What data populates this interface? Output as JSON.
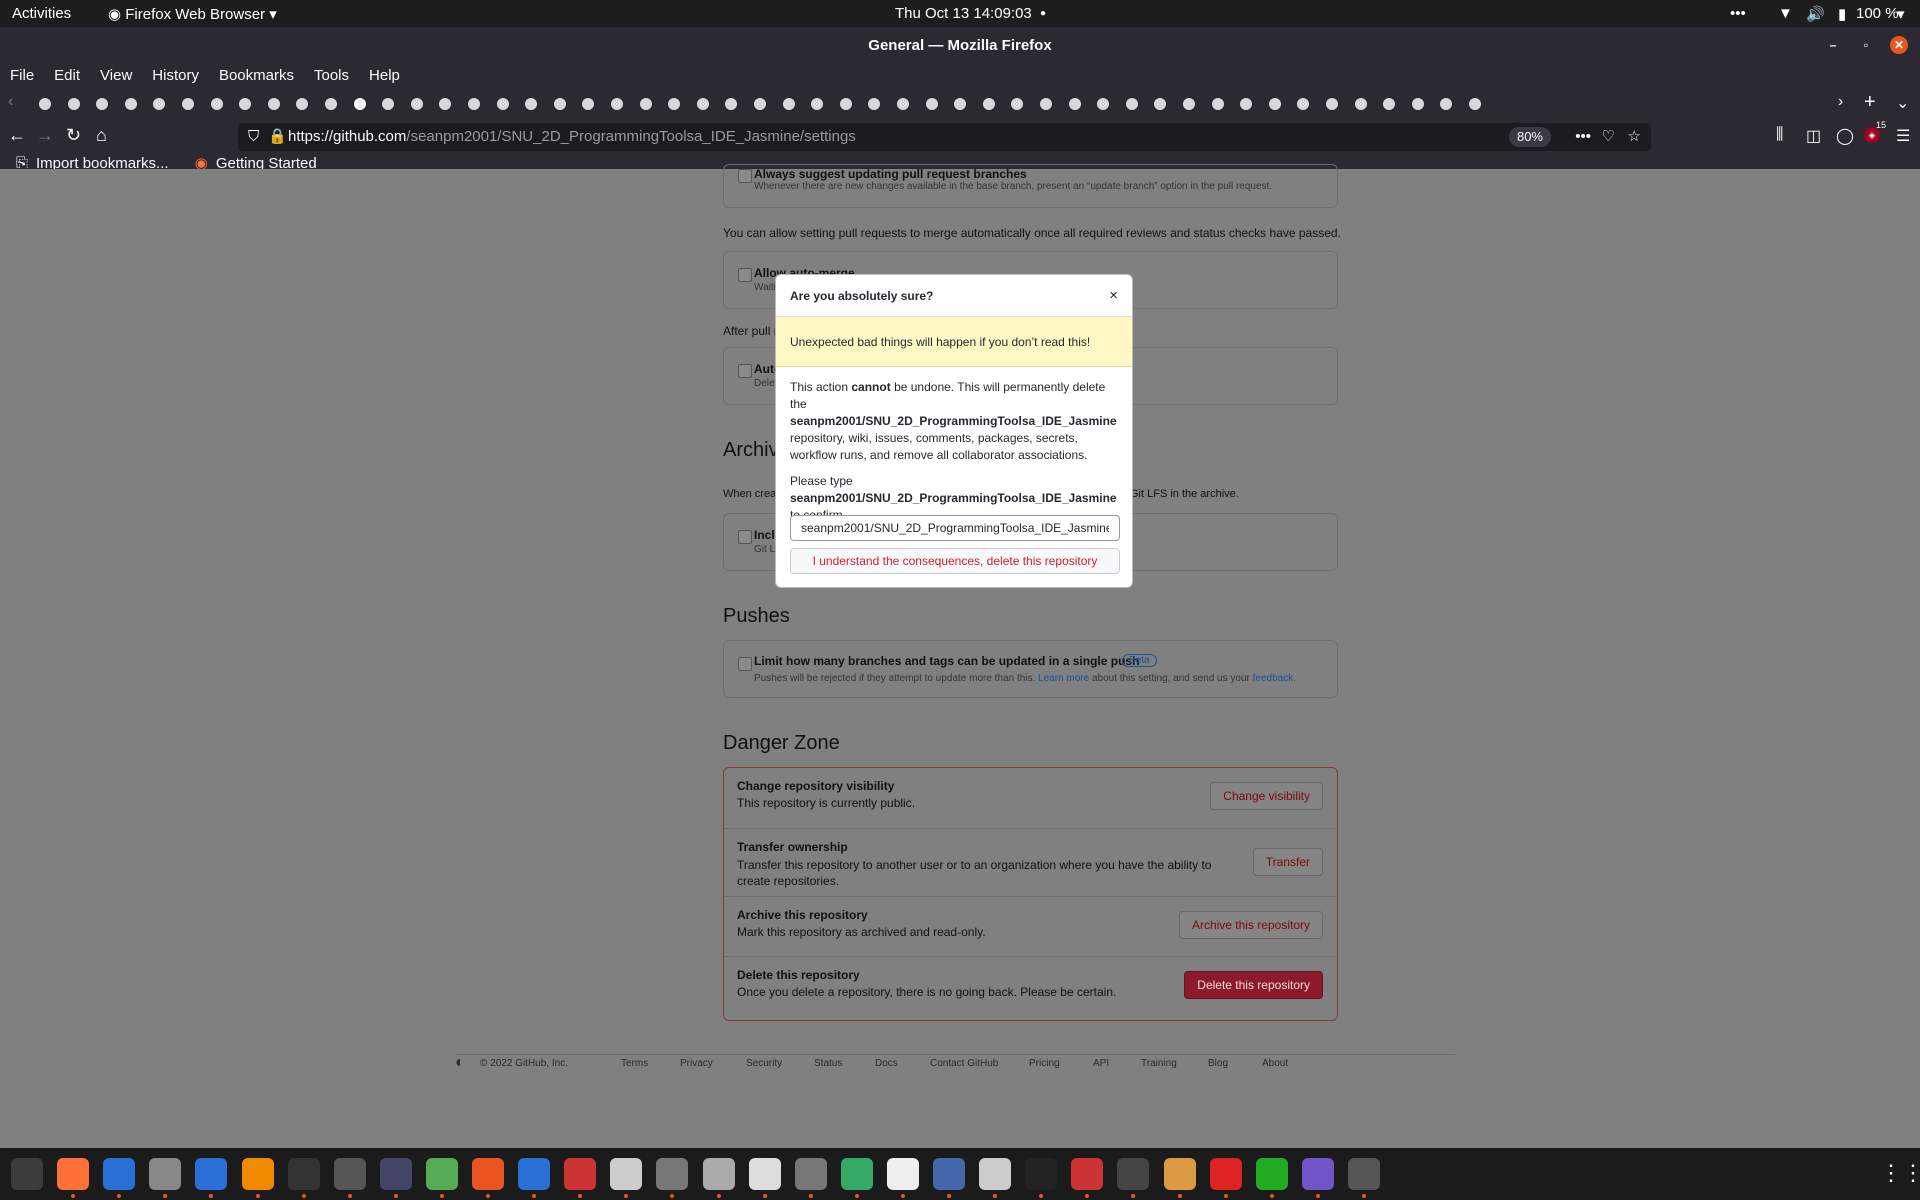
{
  "system_bar": {
    "activities": "Activities",
    "app_menu": "Firefox Web Browser",
    "datetime": "Thu Oct 13  14:09:03",
    "battery": "100 %"
  },
  "window": {
    "title": "General — Mozilla Firefox"
  },
  "menu": [
    "File",
    "Edit",
    "View",
    "History",
    "Bookmarks",
    "Tools",
    "Help"
  ],
  "nav": {
    "url_host": "https://github.com",
    "url_path": "/seanpm2001/SNU_2D_ProgrammingToolsa_IDE_Jasmine/settings",
    "zoom": "80%",
    "notifications_badge": "15"
  },
  "bookmarks": {
    "import": "Import bookmarks...",
    "getting_started": "Getting Started"
  },
  "settings_page": {
    "pr_update_title": "Always suggest updating pull request branches",
    "pr_update_desc": "Whenever there are new changes available in the base branch, present an “update branch” option in the pull request.",
    "automerge_note": "You can allow setting pull requests to merge automatically once all required reviews and status checks have passed.",
    "automerge_title": "Allow auto-merge",
    "automerge_desc": "Waiti",
    "after_pull": "After pull r",
    "autodelete_title": "Auto",
    "autodelete_desc": "Delet",
    "archives_heading": "Archiv",
    "archives_desc_start": "When crea",
    "archives_desc_end": "Git LFS in the archive.",
    "include_lfs_title": "Incl",
    "include_lfs_desc": "Git L",
    "pushes_heading": "Pushes",
    "limit_push_title": "Limit how many branches and tags can be updated in a single push",
    "beta": "Beta",
    "limit_push_desc_a": "Pushes will be rejected if they attempt to update more than this.",
    "learn_more": "Learn more",
    "limit_push_desc_b": "about this setting, and send us your",
    "feedback": "feedback.",
    "danger_heading": "Danger Zone",
    "danger_rows": [
      {
        "title": "Change repository visibility",
        "desc": "This repository is currently public.",
        "button": "Change visibility"
      },
      {
        "title": "Transfer ownership",
        "desc": "Transfer this repository to another user or to an organization where you have the ability to create repositories.",
        "button": "Transfer"
      },
      {
        "title": "Archive this repository",
        "desc": "Mark this repository as archived and read-only.",
        "button": "Archive this repository"
      },
      {
        "title": "Delete this repository",
        "desc": "Once you delete a repository, there is no going back. Please be certain.",
        "button": "Delete this repository"
      }
    ]
  },
  "modal": {
    "title": "Are you absolutely sure?",
    "close": "×",
    "warning": "Unexpected bad things will happen if you don’t read this!",
    "p1_a": "This action",
    "p1_strong": "cannot",
    "p1_b": "be undone. This will permanently delete the",
    "repo": "seanpm2001/SNU_2D_ProgrammingToolsa_IDE_Jasmine",
    "p1_c": "repository, wiki, issues, comments, packages, secrets, workflow runs, and remove all collaborator associations.",
    "p2_a": "Please type",
    "p2_b": "to confirm.",
    "input_value": "seanpm2001/SNU_2D_ProgrammingToolsa_IDE_Jasmine",
    "confirm_button": "I understand the consequences, delete this repository"
  },
  "footer": {
    "copyright": "© 2022 GitHub, Inc.",
    "links": [
      "Terms",
      "Privacy",
      "Security",
      "Status",
      "Docs",
      "Contact GitHub",
      "Pricing",
      "API",
      "Training",
      "Blog",
      "About"
    ]
  },
  "colors": {
    "danger": "#cf222e",
    "delete_btn_bg": "#8b1a2b",
    "warning_bg": "#fff8c5",
    "link": "#1b4f9a"
  }
}
